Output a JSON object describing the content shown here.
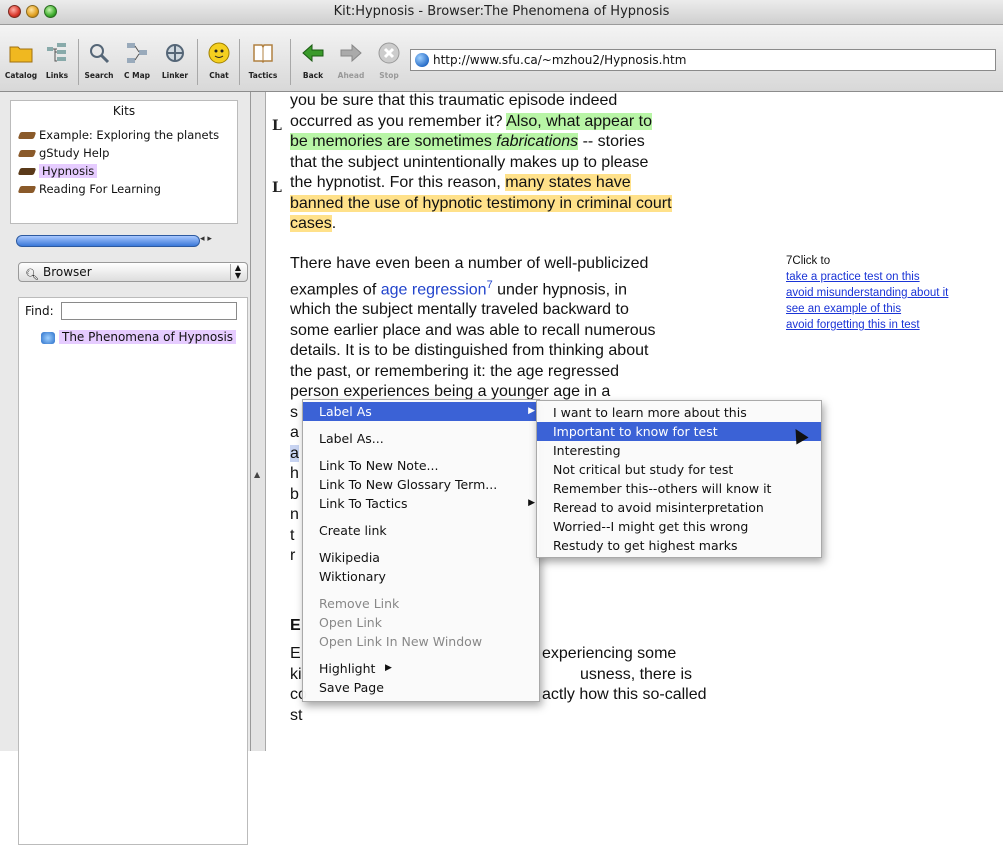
{
  "window": {
    "title": "Kit:Hypnosis - Browser:The Phenomena of Hypnosis"
  },
  "toolbar": {
    "buttons": [
      {
        "label": "Catalog",
        "icon": "folder-icon"
      },
      {
        "label": "Links",
        "icon": "links-icon"
      },
      {
        "label": "Search",
        "icon": "search-icon"
      },
      {
        "label": "C Map",
        "icon": "concept-map-icon"
      },
      {
        "label": "Linker",
        "icon": "linker-icon"
      },
      {
        "label": "Chat",
        "icon": "chat-icon"
      },
      {
        "label": "Tactics",
        "icon": "tactics-icon"
      },
      {
        "label": "Back",
        "icon": "back-arrow-icon"
      },
      {
        "label": "Ahead",
        "icon": "forward-arrow-icon"
      },
      {
        "label": "Stop",
        "icon": "stop-icon"
      }
    ],
    "url": "http://www.sfu.ca/~mzhou2/Hypnosis.htm"
  },
  "sidebar": {
    "kits_title": "Kits",
    "kits": [
      {
        "label": "Example: Exploring the planets"
      },
      {
        "label": "gStudy Help"
      },
      {
        "label": "Hypnosis"
      },
      {
        "label": "Reading For Learning"
      }
    ],
    "browser_select": "Browser",
    "find_label": "Find:",
    "find_value": "",
    "documents": [
      {
        "label": "The Phenomena of Hypnosis"
      }
    ]
  },
  "content": {
    "margin_mark": "L",
    "p1": {
      "l1": "you be sure that this traumatic episode indeed",
      "l2a": "occurred as you remember it? ",
      "l2b": "Also, what appear to",
      "l3a": "be memories are sometimes ",
      "l3b": "fabrications",
      "l3c": " -- stories",
      "l4": "that the subject unintentionally makes up to please",
      "l5a": "the hypnotist. For this reason, ",
      "l5b": "many states have",
      "l6": "banned the use of hypnotic testimony in criminal court",
      "l7a": "cases",
      "l7b": "."
    },
    "p2": {
      "l1": "There have even been a number of well-publicized",
      "l2a": "examples of ",
      "l2b": "age regression",
      "l2c": "7",
      "l2d": " under hypnosis, in",
      "l3": "which the subject mentally traveled backward to",
      "l4": "some earlier place and was able to recall numerous",
      "l5": "details. It is to be distinguished from thinking about",
      "l6": "the past, or remembering it: the age regressed",
      "l7": "person experiences being a younger age in a",
      "l8": "s",
      "l9": "a",
      "l10": "a",
      "l11": "h",
      "l12": "b",
      "l13": "n",
      "l14": "t",
      "l15": "r"
    },
    "heading": "E",
    "p3": {
      "l1a": "E",
      "l1b": "experiencing some",
      "l2a": "ki",
      "l2b": "usness, there is",
      "l3a": "co",
      "l3b": "actly how this so-called",
      "l4a": "st"
    },
    "side_note": {
      "intro": "7Click to",
      "links": [
        "take a practice test on this",
        "avoid misunderstanding about it",
        "see an example of this",
        "avoid forgetting this in test"
      ]
    }
  },
  "context_menu": {
    "items": [
      {
        "label": "Label As",
        "selected": true,
        "submenu": true
      },
      {
        "label": "Label As...",
        "disabled": false
      },
      {
        "label": "Link To New Note..."
      },
      {
        "label": "Link To New Glossary Term..."
      },
      {
        "label": "Link To Tactics",
        "submenu": true
      },
      {
        "label": "Create link"
      },
      {
        "label": "Wikipedia"
      },
      {
        "label": "Wiktionary"
      },
      {
        "label": "Remove Link",
        "disabled": true
      },
      {
        "label": "Open Link",
        "disabled": true
      },
      {
        "label": "Open Link In New Window",
        "disabled": true
      },
      {
        "label": "Highlight",
        "submenu": true
      },
      {
        "label": "Save Page"
      }
    ]
  },
  "submenu": {
    "items": [
      {
        "label": "I want to learn more about this"
      },
      {
        "label": "Important to know for test",
        "selected": true
      },
      {
        "label": "Interesting"
      },
      {
        "label": "Not critical but study for test"
      },
      {
        "label": "Remember this--others will know it"
      },
      {
        "label": "Reread to avoid misinterpretation"
      },
      {
        "label": "Worried--I might get this wrong"
      },
      {
        "label": "Restudy to get highest marks"
      }
    ]
  },
  "colors": {
    "highlight_green": "#b8f5a6",
    "highlight_yellow": "#ffe18a",
    "selection_blue": "#3b62d6",
    "link_blue": "#1a34d6"
  }
}
